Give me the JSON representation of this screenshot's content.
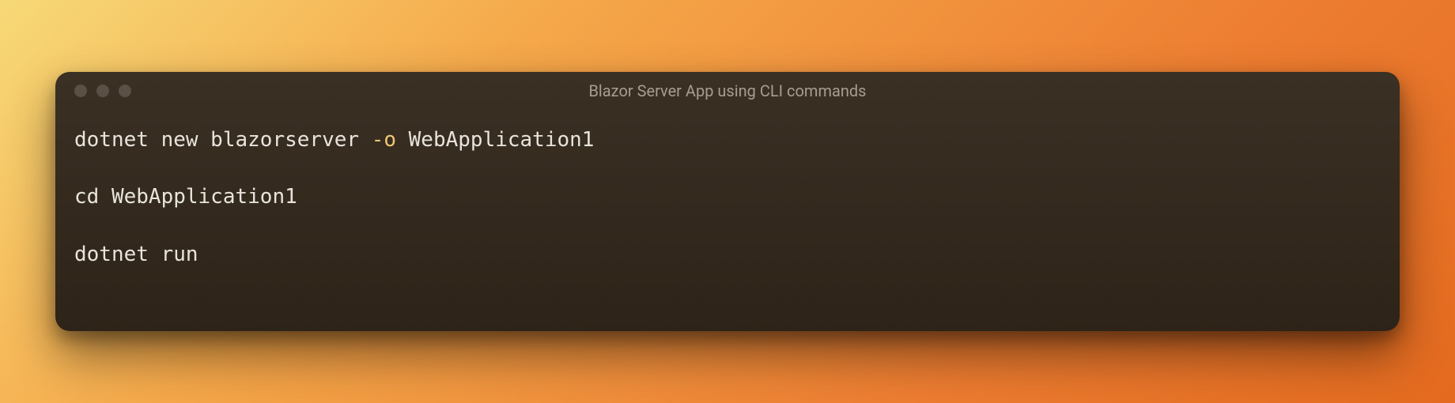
{
  "window": {
    "title": "Blazor Server App using CLI commands"
  },
  "code": {
    "lines": [
      {
        "segments": [
          {
            "text": "dotnet new blazorserver ",
            "class": "plain"
          },
          {
            "text": "-o",
            "class": "flag"
          },
          {
            "text": " WebApplication1",
            "class": "plain"
          }
        ]
      },
      {
        "segments": [
          {
            "text": "cd WebApplication1",
            "class": "plain"
          }
        ]
      },
      {
        "segments": [
          {
            "text": "dotnet run",
            "class": "plain"
          }
        ]
      }
    ]
  },
  "colors": {
    "flag": "#f0c674",
    "text": "#e8e4dc",
    "windowBg": "#2d2318",
    "titleColor": "#a89d8f"
  }
}
